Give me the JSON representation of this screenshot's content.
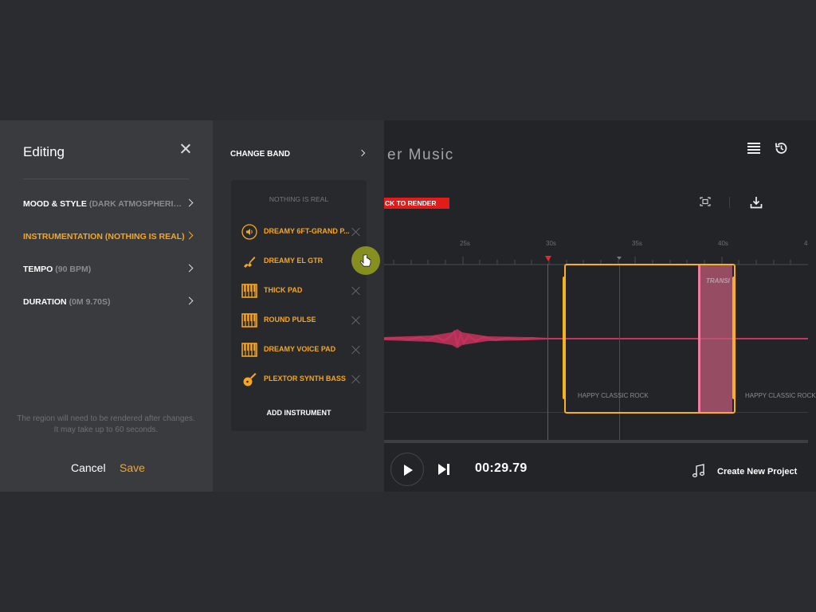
{
  "colors": {
    "accent": "#f6a623",
    "render_badge": "#e21b1b",
    "waveform": "#c7345e",
    "transition": "#be5a78"
  },
  "editing_panel": {
    "title": "Editing",
    "menu": [
      {
        "label": "MOOD & STYLE",
        "value": "(DARK ATMOSPHERIC C...",
        "active": false
      },
      {
        "label": "INSTRUMENTATION",
        "value": "(NOTHING IS REAL)",
        "active": true
      },
      {
        "label": "TEMPO",
        "value": "(90 BPM)",
        "active": false
      },
      {
        "label": "DURATION",
        "value": "(0M 9.70S)",
        "active": false
      }
    ],
    "note_line1": "The region will need to be rendered after changes.",
    "note_line2": "It may take up to 60 seconds.",
    "cancel_label": "Cancel",
    "save_label": "Save"
  },
  "band_panel": {
    "change_band_label": "CHANGE BAND",
    "band_name": "NOTHING IS REAL",
    "instruments": [
      {
        "name": "DREAMY 6FT-GRAND P...",
        "icon": "speaker-icon"
      },
      {
        "name": "DREAMY EL GTR",
        "icon": "electric-guitar-icon"
      },
      {
        "name": "THICK PAD",
        "icon": "keyboard-icon"
      },
      {
        "name": "ROUND PULSE",
        "icon": "keyboard-icon"
      },
      {
        "name": "DREAMY VOICE PAD",
        "icon": "keyboard-icon"
      },
      {
        "name": "PLEXTOR SYNTH BASS",
        "icon": "acoustic-guitar-icon"
      }
    ],
    "add_instrument_label": "ADD INSTRUMENT"
  },
  "main": {
    "project_title": "er Music",
    "render_badge": "CK TO RENDER",
    "ruler_ticks": [
      "25s",
      "30s",
      "35s",
      "40s",
      "4"
    ],
    "transition_label": "TRANSI",
    "region_label_1": "HAPPY CLASSIC ROCK",
    "region_label_2": "HAPPY CLASSIC ROCK",
    "time": "00:29.79",
    "create_project_label": "Create New Project"
  }
}
